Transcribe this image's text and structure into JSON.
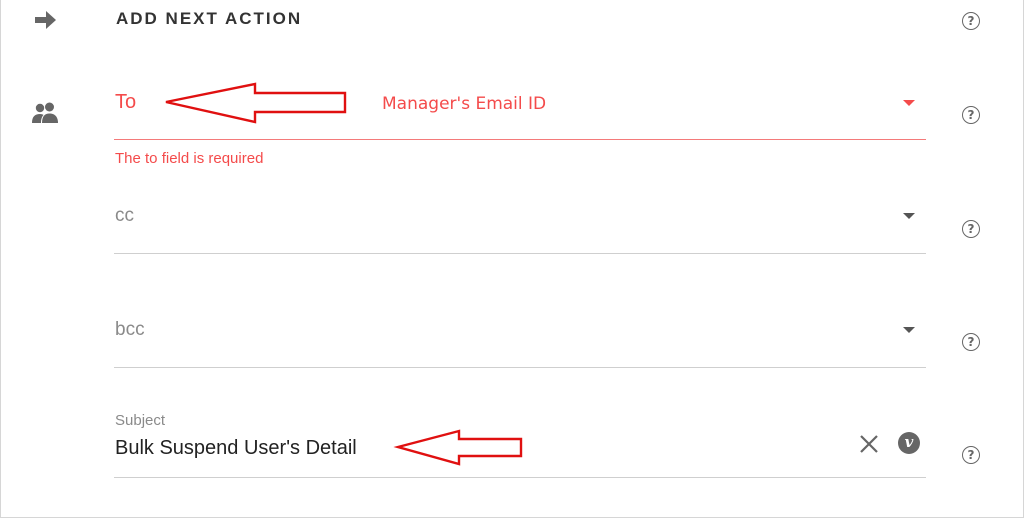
{
  "section": {
    "title": "ADD NEXT ACTION"
  },
  "to_field": {
    "label": "To",
    "value": "Manager's Email ID",
    "error": "The to field is required"
  },
  "cc_field": {
    "label": "cc"
  },
  "bcc_field": {
    "label": "bcc"
  },
  "subject_field": {
    "label": "Subject",
    "value": "Bulk Suspend User's Detail",
    "clear_icon": "close-icon",
    "variable_badge": "v"
  },
  "help_icon_glyph": "?",
  "colors": {
    "error": "#f44b4b",
    "annotation": "#e01010",
    "text": "#333333",
    "muted": "#8a8a8a"
  }
}
